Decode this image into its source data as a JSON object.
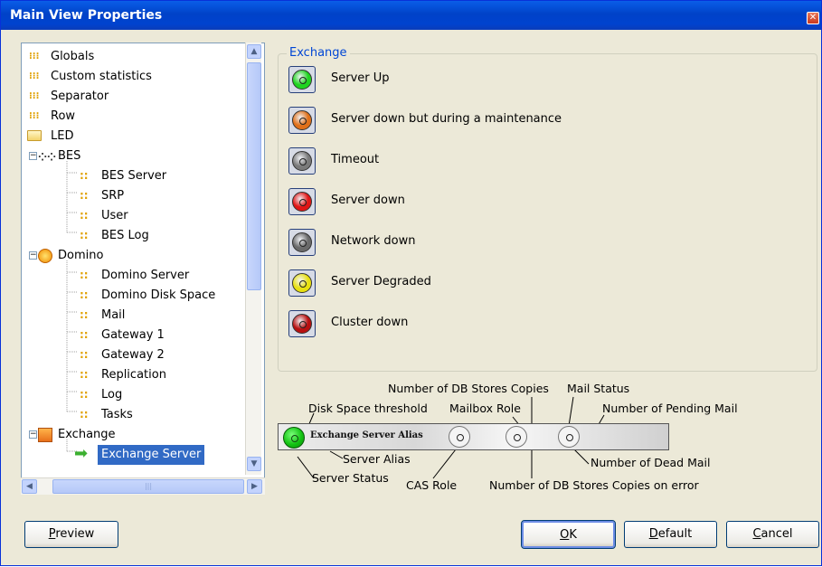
{
  "window": {
    "title": "Main View Properties",
    "close_icon": "close-icon"
  },
  "tree": {
    "items": [
      {
        "label": "Globals",
        "icon": "dots-icon"
      },
      {
        "label": "Custom statistics",
        "icon": "dots-icon"
      },
      {
        "label": "Separator",
        "icon": "dots-icon"
      },
      {
        "label": "Row",
        "icon": "dots-icon"
      },
      {
        "label": "LED",
        "icon": "folder-icon"
      },
      {
        "label": "BES",
        "icon": "blackberry-icon",
        "expander": "−"
      },
      {
        "label": "BES Server",
        "icon": "small-dots-icon"
      },
      {
        "label": "SRP",
        "icon": "small-dots-icon"
      },
      {
        "label": "User",
        "icon": "small-dots-icon"
      },
      {
        "label": "BES Log",
        "icon": "small-dots-icon"
      },
      {
        "label": "Domino",
        "icon": "domino-icon",
        "expander": "−"
      },
      {
        "label": "Domino Server",
        "icon": "small-dots-icon"
      },
      {
        "label": "Domino Disk Space",
        "icon": "small-dots-icon"
      },
      {
        "label": "Mail",
        "icon": "small-dots-icon"
      },
      {
        "label": "Gateway 1",
        "icon": "small-dots-icon"
      },
      {
        "label": "Gateway 2",
        "icon": "small-dots-icon"
      },
      {
        "label": "Replication",
        "icon": "small-dots-icon"
      },
      {
        "label": "Log",
        "icon": "small-dots-icon"
      },
      {
        "label": "Tasks",
        "icon": "small-dots-icon"
      },
      {
        "label": "Exchange",
        "icon": "exchange-icon",
        "expander": "−"
      },
      {
        "label": "Exchange Server",
        "icon": "green-arrow-icon",
        "selected": true
      }
    ]
  },
  "group": {
    "title": "Exchange",
    "leds": [
      {
        "label": "Server Up",
        "color": "#1fd41f"
      },
      {
        "label": "Server down but during a maintenance",
        "color": "#e0701a"
      },
      {
        "label": "Timeout",
        "color": "#7a7a7a"
      },
      {
        "label": "Server down",
        "color": "#e01515"
      },
      {
        "label": "Network down",
        "color": "#6a6a6a"
      },
      {
        "label": "Server Degraded",
        "color": "#e8e010"
      },
      {
        "label": "Cluster down",
        "color": "#b81010"
      }
    ]
  },
  "preview": {
    "alias": "Exchange Server Alias",
    "annotations": {
      "disk_space": "Disk Space threshold",
      "db_copies": "Number of DB Stores Copies",
      "mail_status": "Mail Status",
      "mailbox_role": "Mailbox Role",
      "pending_mail": "Number of Pending Mail",
      "server_alias": "Server Alias",
      "dead_mail": "Number of Dead Mail",
      "server_status": "Server Status",
      "cas_role": "CAS Role",
      "db_copies_error": "Number of DB Stores Copies on error"
    }
  },
  "buttons": {
    "preview": {
      "first": "P",
      "rest": "review"
    },
    "ok": {
      "first": "O",
      "rest": "K"
    },
    "default": {
      "first": "D",
      "rest": "efault"
    },
    "cancel": {
      "first": "C",
      "rest": "ancel"
    }
  }
}
